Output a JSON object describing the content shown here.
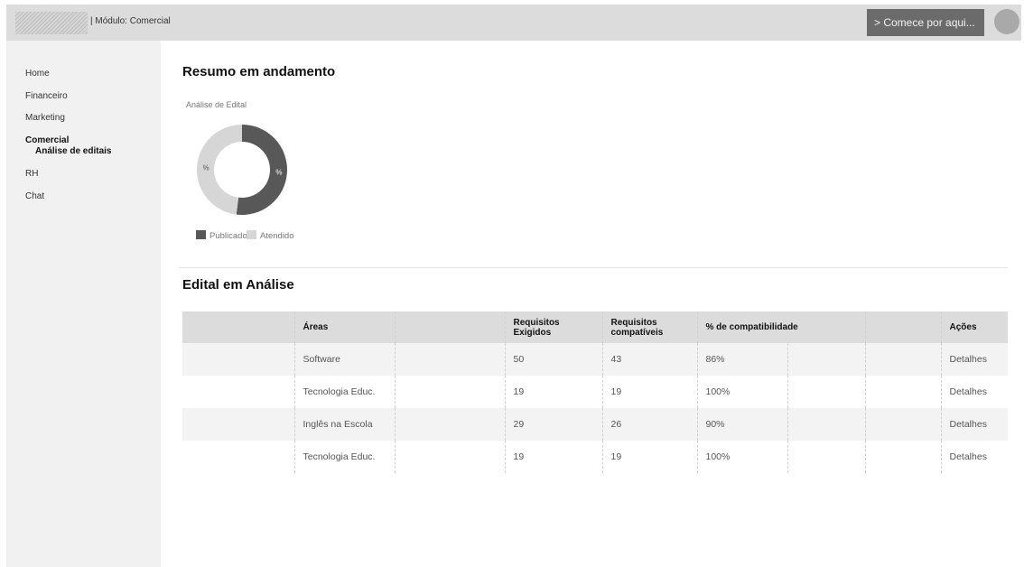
{
  "header": {
    "module_label": "| Módulo: Comercial",
    "start_button": "> Comece por aqui..."
  },
  "sidebar": {
    "items": [
      {
        "label": "Home"
      },
      {
        "label": "Financeiro"
      },
      {
        "label": "Marketing"
      },
      {
        "label": "Comercial",
        "active": true
      },
      {
        "label": "RH"
      },
      {
        "label": "Chat"
      }
    ],
    "sub_item": "Análise de editais"
  },
  "summary": {
    "title": "Resumo em andamento",
    "chart_title": "Análise de Edital"
  },
  "chart_data": {
    "type": "pie",
    "title": "Análise de Edital",
    "donut": true,
    "categories": [
      "Publicado",
      "Atendido"
    ],
    "values": [
      52,
      48
    ],
    "slice_labels": [
      "%",
      "%"
    ],
    "colors": [
      "#585858",
      "#d6d6d6"
    ],
    "legend": "bottom-left"
  },
  "table_section": {
    "title": "Edital em Análise",
    "columns": [
      "",
      "Áreas",
      "",
      "Requisitos Exigidos",
      "Requisitos compatíveis",
      "% de compatibilidade",
      "",
      "",
      "Ações"
    ],
    "rows": [
      {
        "area": "Software",
        "exigidos": "50",
        "compativeis": "43",
        "compat": "86%",
        "action": "Detalhes"
      },
      {
        "area": "Tecnologia Educ.",
        "exigidos": "19",
        "compativeis": "19",
        "compat": "100%",
        "action": "Detalhes"
      },
      {
        "area": "Inglês na Escola",
        "exigidos": "29",
        "compativeis": "26",
        "compat": "90%",
        "action": "Detalhes"
      },
      {
        "area": "Tecnologia Educ.",
        "exigidos": "19",
        "compativeis": "19",
        "compat": "100%",
        "action": "Detalhes"
      }
    ]
  }
}
